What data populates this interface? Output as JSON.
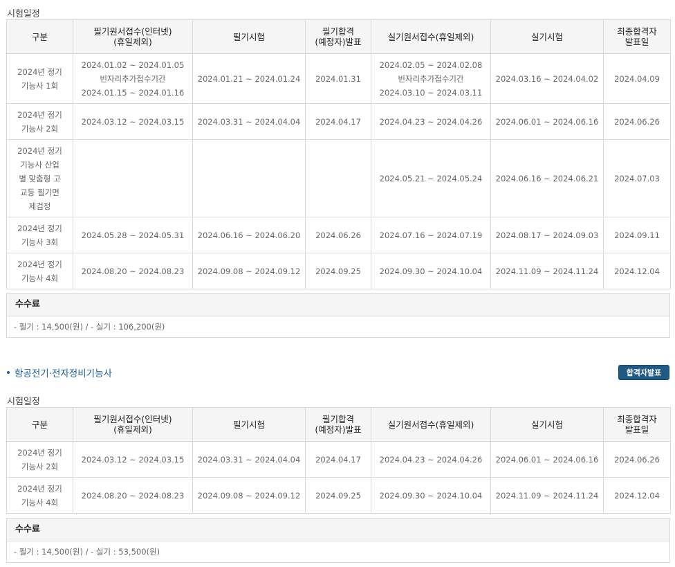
{
  "headers": [
    "구분",
    "필기원서접수(인터넷)\n(휴일제외)",
    "필기시험",
    "필기합격\n(예정자)발표",
    "실기원서접수(휴일제외)",
    "실기시험",
    "최종합격자\n발표일"
  ],
  "section1": {
    "title": "시험일정",
    "rows": [
      {
        "name": "2024년 정기\n기능사 1회",
        "written_apply": "2024.01.02 ~ 2024.01.05\n빈자리추가접수기간\n2024.01.15 ~ 2024.01.16",
        "written_exam": "2024.01.21 ~ 2024.01.24",
        "written_result": "2024.01.31",
        "practical_apply": "2024.02.05 ~ 2024.02.08\n빈자리추가접수기간\n2024.03.10 ~ 2024.03.11",
        "practical_exam": "2024.03.16 ~ 2024.04.02",
        "final_result": "2024.04.09"
      },
      {
        "name": "2024년 정기\n기능사 2회",
        "written_apply": "2024.03.12 ~ 2024.03.15",
        "written_exam": "2024.03.31 ~ 2024.04.04",
        "written_result": "2024.04.17",
        "practical_apply": "2024.04.23 ~ 2024.04.26",
        "practical_exam": "2024.06.01 ~ 2024.06.16",
        "final_result": "2024.06.26"
      },
      {
        "name": "2024년 정기\n기능사 산업\n별 맞춤형 고\n교등 필기면\n제검정",
        "written_apply": "",
        "written_exam": "",
        "written_result": "",
        "practical_apply": "2024.05.21 ~ 2024.05.24",
        "practical_exam": "2024.06.16 ~ 2024.06.21",
        "final_result": "2024.07.03"
      },
      {
        "name": "2024년 정기\n기능사 3회",
        "written_apply": "2024.05.28 ~ 2024.05.31",
        "written_exam": "2024.06.16 ~ 2024.06.20",
        "written_result": "2024.06.26",
        "practical_apply": "2024.07.16 ~ 2024.07.19",
        "practical_exam": "2024.08.17 ~ 2024.09.03",
        "final_result": "2024.09.11"
      },
      {
        "name": "2024년 정기\n기능사 4회",
        "written_apply": "2024.08.20 ~ 2024.08.23",
        "written_exam": "2024.09.08 ~ 2024.09.12",
        "written_result": "2024.09.25",
        "practical_apply": "2024.09.30 ~ 2024.10.04",
        "practical_exam": "2024.11.09 ~ 2024.11.24",
        "final_result": "2024.12.04"
      }
    ],
    "fee_label": "수수료",
    "fee_text": "- 필기 : 14,500(원) / - 실기 : 106,200(원)"
  },
  "cert": {
    "name": "항공전기·전자정비기능사",
    "pass_button": "합격자발표"
  },
  "section2": {
    "title": "시험일정",
    "rows": [
      {
        "name": "2024년 정기\n기능사 2회",
        "written_apply": "2024.03.12 ~ 2024.03.15",
        "written_exam": "2024.03.31 ~ 2024.04.04",
        "written_result": "2024.04.17",
        "practical_apply": "2024.04.23 ~ 2024.04.26",
        "practical_exam": "2024.06.01 ~ 2024.06.16",
        "final_result": "2024.06.26"
      },
      {
        "name": "2024년 정기\n기능사 4회",
        "written_apply": "2024.08.20 ~ 2024.08.23",
        "written_exam": "2024.09.08 ~ 2024.09.12",
        "written_result": "2024.09.25",
        "practical_apply": "2024.09.30 ~ 2024.10.04",
        "practical_exam": "2024.11.09 ~ 2024.11.24",
        "final_result": "2024.12.04"
      }
    ],
    "fee_label": "수수료",
    "fee_text": "- 필기 : 14,500(원) / - 실기 : 53,500(원)"
  },
  "colors": {
    "header_bg": "#f5f5f5",
    "border": "#d9d9d9",
    "accent_blue": "#1f5fa0",
    "button_bg": "#205a82"
  }
}
